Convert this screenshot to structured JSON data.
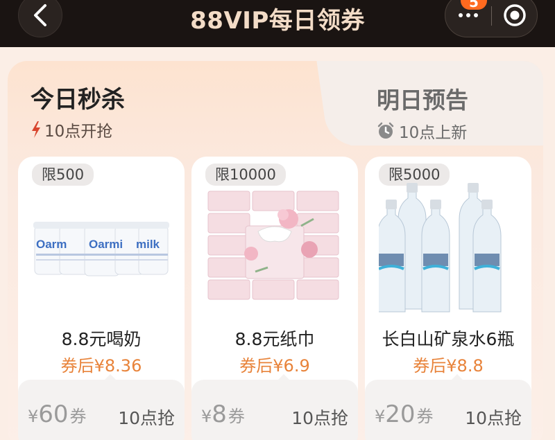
{
  "header": {
    "title": "88VIP每日领券",
    "badge_count": "5"
  },
  "tabs": {
    "active": {
      "label": "今日秒杀",
      "sub": "10点开抢"
    },
    "inactive": {
      "label": "明日预告",
      "sub": "10点上新"
    }
  },
  "products": [
    {
      "limit": "限500",
      "name": "8.8元喝奶",
      "after_price": "券后¥8.36",
      "coupon_currency": "¥",
      "coupon_amount": "60",
      "coupon_unit": "券",
      "start_time": "10点抢",
      "image": "yogurt-cups",
      "brand_text": "Oarmilk"
    },
    {
      "limit": "限10000",
      "name": "8.8元纸巾",
      "after_price": "券后¥6.9",
      "coupon_currency": "¥",
      "coupon_amount": "8",
      "coupon_unit": "券",
      "start_time": "10点抢",
      "image": "tissue-packs"
    },
    {
      "limit": "限5000",
      "name": "长白山矿泉水6瓶",
      "after_price": "券后¥8.8",
      "coupon_currency": "¥",
      "coupon_amount": "20",
      "coupon_unit": "券",
      "start_time": "10点抢",
      "image": "water-bottles"
    }
  ],
  "colors": {
    "header_bg": "#1a1412",
    "title": "#f3dcc7",
    "accent_price": "#e8833a",
    "badge": "#ff6a1f"
  }
}
